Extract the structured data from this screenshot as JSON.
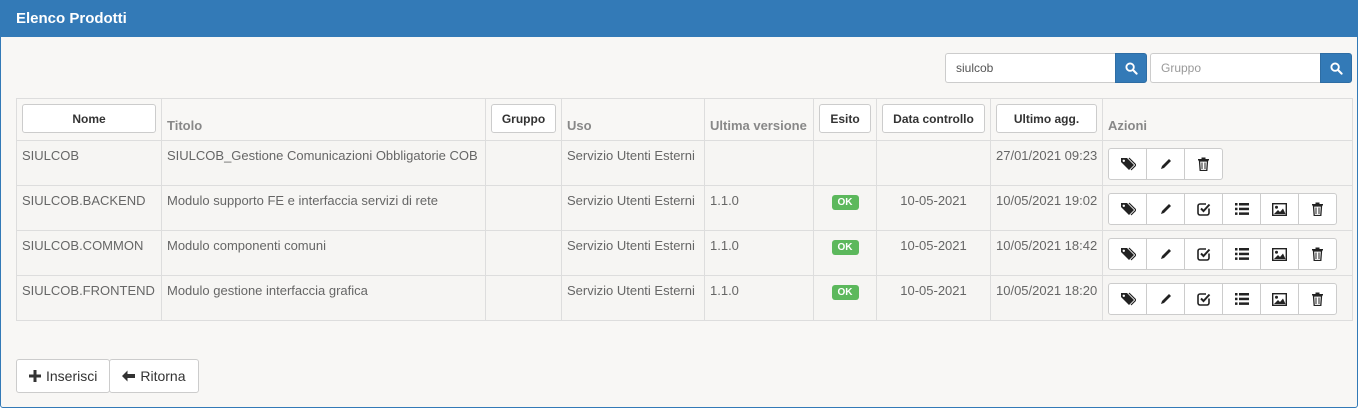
{
  "panel": {
    "title": "Elenco Prodotti"
  },
  "search": {
    "query_value": "siulcob",
    "group_placeholder": "Gruppo",
    "group_value": ""
  },
  "table": {
    "headers": {
      "nome": "Nome",
      "titolo": "Titolo",
      "gruppo": "Gruppo",
      "uso": "Uso",
      "ultima_versione": "Ultima versione",
      "esito": "Esito",
      "data_controllo": "Data controllo",
      "ultimo_agg": "Ultimo agg.",
      "azioni": "Azioni"
    },
    "rows": [
      {
        "nome": "SIULCOB",
        "titolo": "SIULCOB_Gestione Comunicazioni Obbligatorie COB",
        "gruppo": "",
        "uso": "Servizio Utenti Esterni",
        "versione": "",
        "esito": "",
        "data_controllo": "",
        "ultimo_agg": "27/01/2021 09:23"
      },
      {
        "nome": "SIULCOB.BACKEND",
        "titolo": "Modulo supporto FE e interfaccia servizi di rete",
        "gruppo": "",
        "uso": "Servizio Utenti Esterni",
        "versione": "1.1.0",
        "esito": "OK",
        "data_controllo": "10-05-2021",
        "ultimo_agg": "10/05/2021 19:02"
      },
      {
        "nome": "SIULCOB.COMMON",
        "titolo": "Modulo componenti comuni",
        "gruppo": "",
        "uso": "Servizio Utenti Esterni",
        "versione": "1.1.0",
        "esito": "OK",
        "data_controllo": "10-05-2021",
        "ultimo_agg": "10/05/2021 18:42"
      },
      {
        "nome": "SIULCOB.FRONTEND",
        "titolo": "Modulo gestione interfaccia grafica",
        "gruppo": "",
        "uso": "Servizio Utenti Esterni",
        "versione": "1.1.0",
        "esito": "OK",
        "data_controllo": "10-05-2021",
        "ultimo_agg": "10/05/2021 18:20"
      }
    ]
  },
  "footer": {
    "insert_label": "Inserisci",
    "back_label": "Ritorna"
  },
  "colors": {
    "primary": "#337ab7",
    "success": "#5cb85c"
  }
}
